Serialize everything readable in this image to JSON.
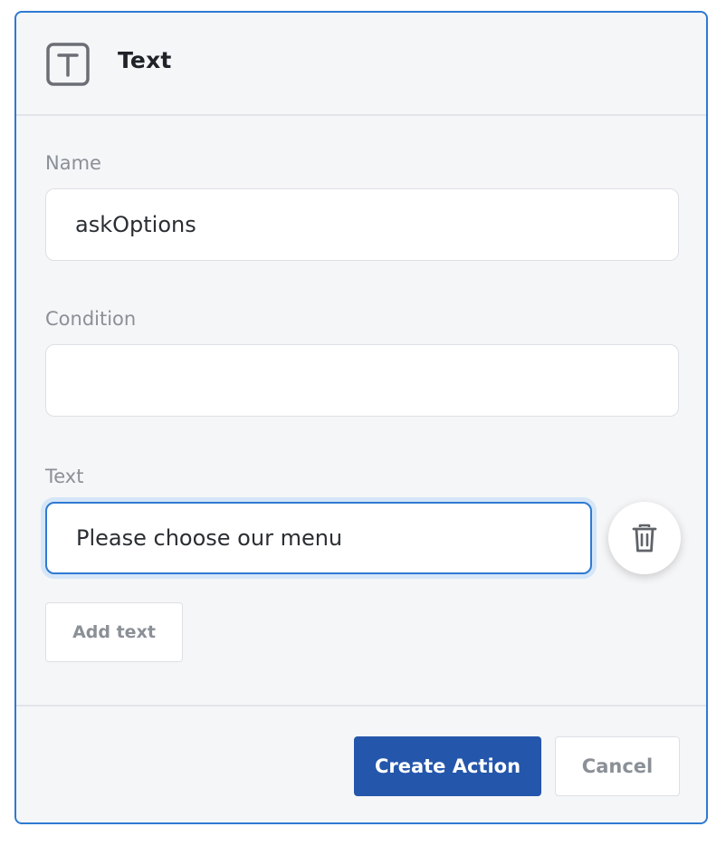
{
  "header": {
    "icon": "text-type-icon",
    "title": "Text"
  },
  "form": {
    "name_label": "Name",
    "name_value": "askOptions",
    "condition_label": "Condition",
    "condition_value": "",
    "text_label": "Text",
    "text_value": "Please choose our menu",
    "delete_icon": "trash-icon",
    "add_text_label": "Add text"
  },
  "footer": {
    "create_label": "Create Action",
    "cancel_label": "Cancel"
  },
  "colors": {
    "accent": "#2f7ad1",
    "primary_button": "#2456ab",
    "muted_text": "#8b9097",
    "panel_bg": "#f5f6f8"
  }
}
